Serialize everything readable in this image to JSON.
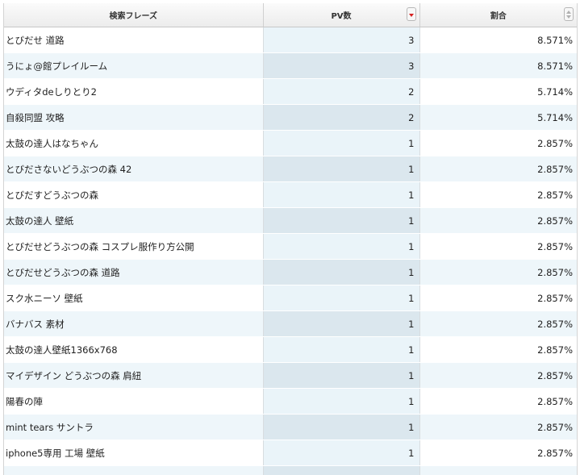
{
  "table": {
    "columns": [
      {
        "label": "検索フレーズ"
      },
      {
        "label": "PV数"
      },
      {
        "label": "割合"
      }
    ],
    "rows": [
      {
        "phrase": "とびだせ 道路",
        "pv": "3",
        "ratio": "8.571%"
      },
      {
        "phrase": "うにょ@館プレイルーム",
        "pv": "3",
        "ratio": "8.571%"
      },
      {
        "phrase": "ウディタdeしりとり2",
        "pv": "2",
        "ratio": "5.714%"
      },
      {
        "phrase": "自殺同盟 攻略",
        "pv": "2",
        "ratio": "5.714%"
      },
      {
        "phrase": "太鼓の達人はなちゃん",
        "pv": "1",
        "ratio": "2.857%"
      },
      {
        "phrase": "とびださないどうぶつの森 42",
        "pv": "1",
        "ratio": "2.857%"
      },
      {
        "phrase": "とびだすどうぶつの森",
        "pv": "1",
        "ratio": "2.857%"
      },
      {
        "phrase": "太鼓の達人 壁紙",
        "pv": "1",
        "ratio": "2.857%"
      },
      {
        "phrase": "とびだせどうぶつの森 コスプレ服作り方公開",
        "pv": "1",
        "ratio": "2.857%"
      },
      {
        "phrase": "とびだせどうぶつの森 道路",
        "pv": "1",
        "ratio": "2.857%"
      },
      {
        "phrase": "スク水ニーソ 壁紙",
        "pv": "1",
        "ratio": "2.857%"
      },
      {
        "phrase": "バナバス 素材",
        "pv": "1",
        "ratio": "2.857%"
      },
      {
        "phrase": "太鼓の達人壁紙1366x768",
        "pv": "1",
        "ratio": "2.857%"
      },
      {
        "phrase": "マイデザイン どうぶつの森 肩紐",
        "pv": "1",
        "ratio": "2.857%"
      },
      {
        "phrase": "陽春の陣",
        "pv": "1",
        "ratio": "2.857%"
      },
      {
        "phrase": "mint tears サントラ",
        "pv": "1",
        "ratio": "2.857%"
      },
      {
        "phrase": "iphone5専用 工場 壁紙",
        "pv": "1",
        "ratio": "2.857%"
      },
      {
        "phrase": "",
        "pv": "",
        "ratio": ""
      }
    ],
    "sort": {
      "column": "PV数",
      "direction": "descending"
    },
    "colors": {
      "sort_active": "#d62020",
      "row_alt": "#eef6fa",
      "sorted_column": "#eaf4f9"
    }
  }
}
